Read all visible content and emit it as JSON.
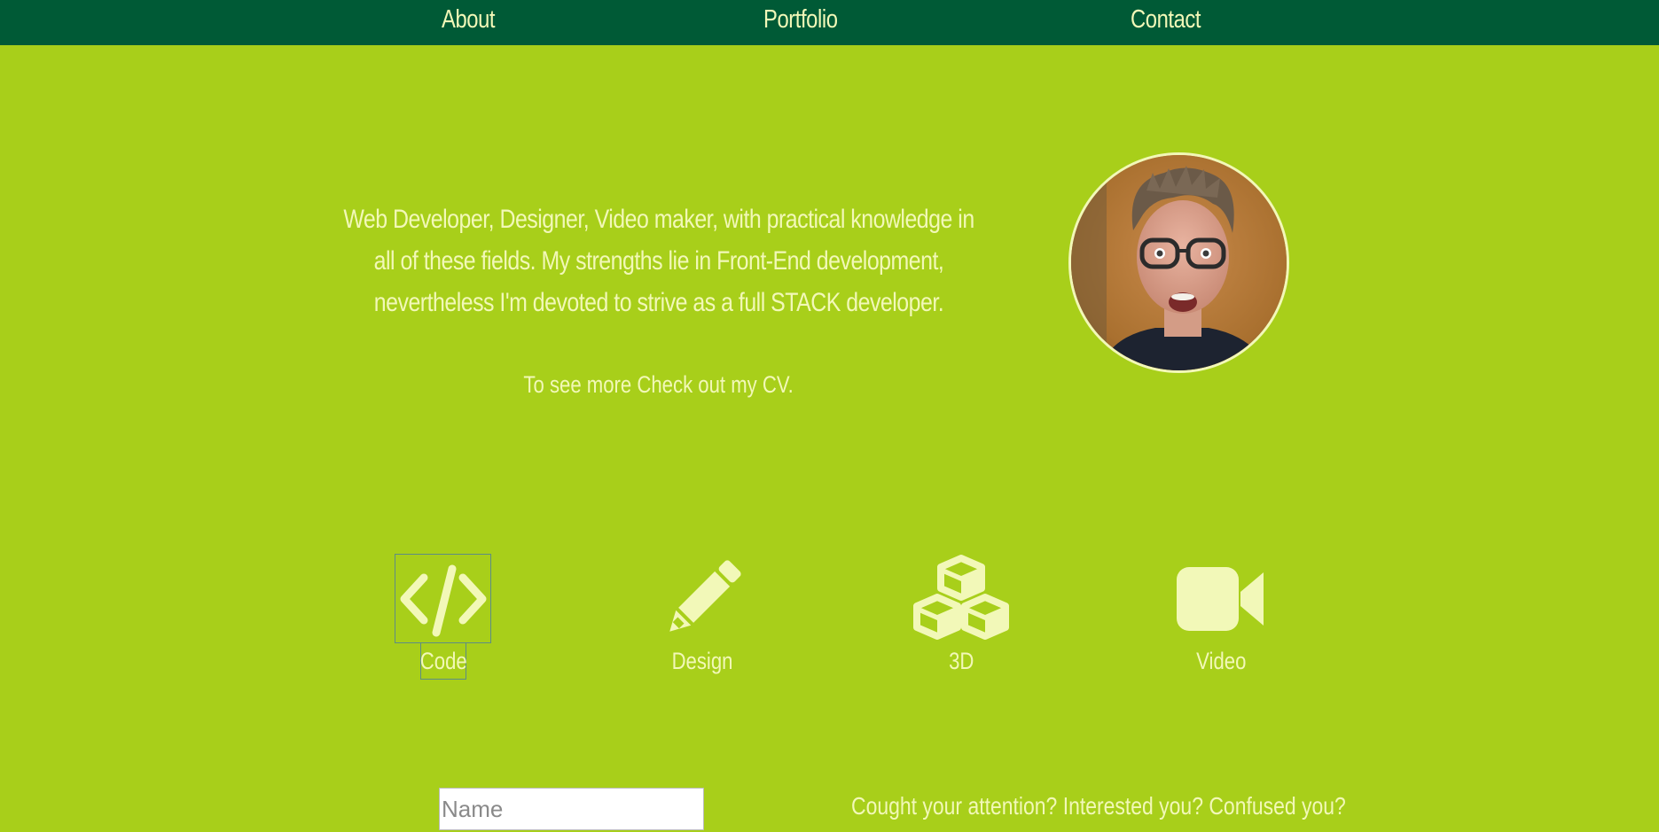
{
  "nav": {
    "items": [
      {
        "label": "About"
      },
      {
        "label": "Portfolio"
      },
      {
        "label": "Contact"
      }
    ]
  },
  "intro": {
    "bio": "Web Developer, Designer, Video maker, with practical knowledge in all of these fields. My strengths lie in Front-End development, nevertheless I'm devoted to strive as a full STACK developer.",
    "cv_text": "To see more Check out my CV."
  },
  "skills": [
    {
      "label": "Code",
      "icon": "code-icon"
    },
    {
      "label": "Design",
      "icon": "pencil-icon"
    },
    {
      "label": "3D",
      "icon": "cubes-icon"
    },
    {
      "label": "Video",
      "icon": "video-camera-icon"
    }
  ],
  "contact": {
    "name_placeholder": "Name",
    "tagline": "Cought your attention? Interested you? Confused you?"
  },
  "colors": {
    "background": "#a8cf1a",
    "nav_background": "#005a36",
    "text": "#f2f8b8"
  }
}
